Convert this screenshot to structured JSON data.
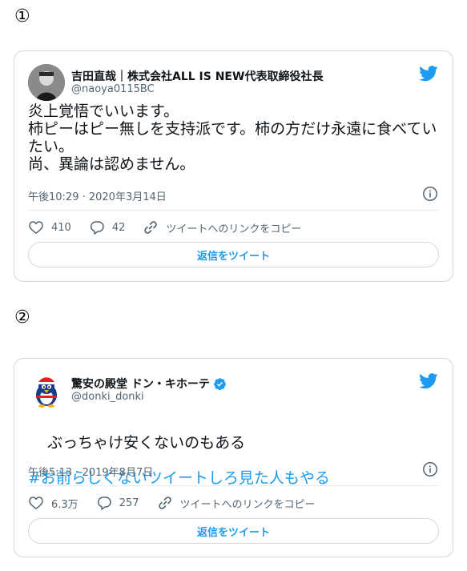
{
  "markers": [
    "①",
    "②"
  ],
  "tweets": [
    {
      "display_name": "吉田直哉｜株式会社ALL IS NEW代表取締役社長",
      "handle": "@naoya0115BC",
      "verified": false,
      "text": "炎上覚悟でいいます。\n柿ピーはピー無しを支持派です。柿の方だけ永遠に食べていたい。\n尚、異論は認めません。",
      "hashtag": "",
      "timestamp": "午後10:29 · 2020年3月14日",
      "likes": "410",
      "replies": "42",
      "copy_link_label": "ツイートへのリンクをコピー",
      "reply_button_label": "返信をツイート",
      "avatar": "person-photo"
    },
    {
      "display_name": "驚安の殿堂 ドン・キホーテ",
      "handle": "@donki_donki",
      "verified": true,
      "text": "ぶっちゃけ安くないのもある",
      "hashtag": "#お前らしくないツイートしろ見た人もやる",
      "timestamp": "午後5:13 · 2019年8月7日",
      "likes": "6.3万",
      "replies": "257",
      "copy_link_label": "ツイートへのリンクをコピー",
      "reply_button_label": "返信をツイート",
      "avatar": "penguin-mascot"
    }
  ],
  "icons": {
    "brand": "twitter-bird-icon",
    "info": "info-icon",
    "like": "heart-icon",
    "reply": "speech-bubble-icon",
    "copy_link": "link-icon",
    "verified": "verified-badge-icon"
  },
  "colors": {
    "accent": "#1d9bf0",
    "text": "#0f1419",
    "muted": "#536471",
    "border": "#cfd9de"
  }
}
